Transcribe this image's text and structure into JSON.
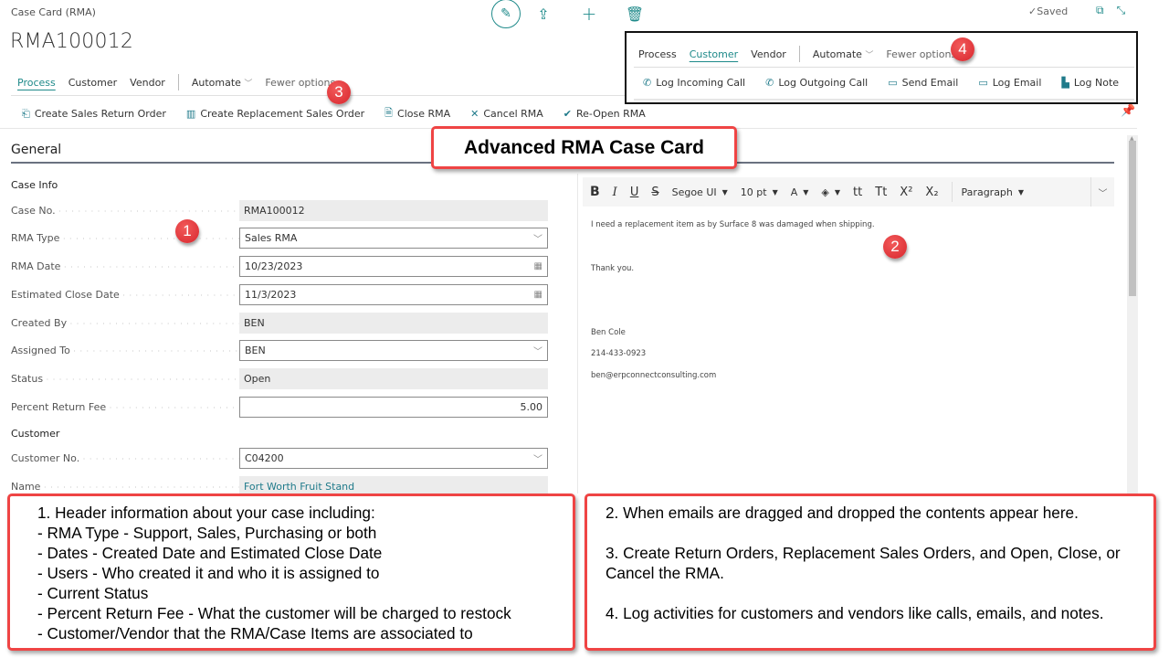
{
  "header": {
    "breadcrumb": "Case Card (RMA)",
    "title": "RMA100012",
    "saved_status": "Saved",
    "top_icons": [
      "edit-icon",
      "share-icon",
      "add-icon",
      "delete-icon"
    ]
  },
  "nav": {
    "tabs": [
      "Process",
      "Customer",
      "Vendor"
    ],
    "active_tab": "Process",
    "automate": "Automate",
    "fewer_options": "Fewer options"
  },
  "process_actions": [
    {
      "label": "Create Sales Return Order",
      "icon": "return-order-icon"
    },
    {
      "label": "Create Replacement Sales Order",
      "icon": "replacement-order-icon"
    },
    {
      "label": "Close RMA",
      "icon": "close-document-icon"
    },
    {
      "label": "Cancel RMA",
      "icon": "cancel-x-icon"
    },
    {
      "label": "Re-Open RMA",
      "icon": "reopen-icon"
    }
  ],
  "customer_nav": {
    "tabs": [
      "Process",
      "Customer",
      "Vendor"
    ],
    "active_tab": "Customer",
    "automate": "Automate",
    "fewer_options": "Fewer options"
  },
  "customer_actions": [
    {
      "label": "Log Incoming Call",
      "icon": "phone-icon"
    },
    {
      "label": "Log Outgoing Call",
      "icon": "phone-icon"
    },
    {
      "label": "Send Email",
      "icon": "email-icon"
    },
    {
      "label": "Log Email",
      "icon": "email-icon"
    },
    {
      "label": "Log Note",
      "icon": "note-icon"
    }
  ],
  "general": {
    "title": "General",
    "case_info_title": "Case Info",
    "fields": [
      {
        "label": "Case No.",
        "value": "RMA100012",
        "type": "readonly"
      },
      {
        "label": "RMA Type",
        "value": "Sales RMA",
        "type": "dropdown"
      },
      {
        "label": "RMA Date",
        "value": "10/23/2023",
        "type": "date"
      },
      {
        "label": "Estimated Close Date",
        "value": "11/3/2023",
        "type": "date"
      },
      {
        "label": "Created By",
        "value": "BEN",
        "type": "readonly"
      },
      {
        "label": "Assigned To",
        "value": "BEN",
        "type": "dropdown"
      },
      {
        "label": "Status",
        "value": "Open",
        "type": "readonly"
      },
      {
        "label": "Percent Return Fee",
        "value": "5.00",
        "type": "number"
      }
    ],
    "customer_title": "Customer",
    "customer_fields": [
      {
        "label": "Customer No.",
        "value": "C04200",
        "type": "dropdown"
      },
      {
        "label": "Name",
        "value": "Fort Worth Fruit Stand",
        "type": "readonly-link"
      }
    ]
  },
  "editor": {
    "toolbar": {
      "bold": "B",
      "italic": "I",
      "underline": "U",
      "strike": "S",
      "font": "Segoe UI",
      "size": "10 pt",
      "font_color": "A",
      "tt1": "tt",
      "tt2": "Tt",
      "sup": "X²",
      "sub": "X₂",
      "paragraph": "Paragraph"
    },
    "body": [
      "I need a replacement item as by Surface 8 was damaged when shipping.",
      "Thank you.",
      "Ben Cole",
      "214-433-0923",
      "ben@erpconnectconsulting.com"
    ]
  },
  "callouts": {
    "title": "Advanced RMA Case Card",
    "badges": [
      "1",
      "2",
      "3",
      "4"
    ],
    "note1": [
      "1. Header information about your case including:",
      "- RMA Type - Support, Sales, Purchasing or both",
      "- Dates - Created Date and Estimated Close Date",
      "- Users - Who created it and who it is assigned to",
      "- Current Status",
      "- Percent Return Fee - What the customer will be charged to restock",
      "- Customer/Vendor that the RMA/Case Items are associated to"
    ],
    "note2": [
      "2. When emails are dragged and dropped the contents appear here.",
      "3. Create Return Orders, Replacement Sales Orders, and Open, Close, or Cancel the RMA.",
      "4. Log activities for customers and vendors like calls, emails, and notes."
    ]
  },
  "colors": {
    "accent": "#1f8a8a",
    "callout_border": "#ef4444",
    "badge": "#e02e35"
  }
}
